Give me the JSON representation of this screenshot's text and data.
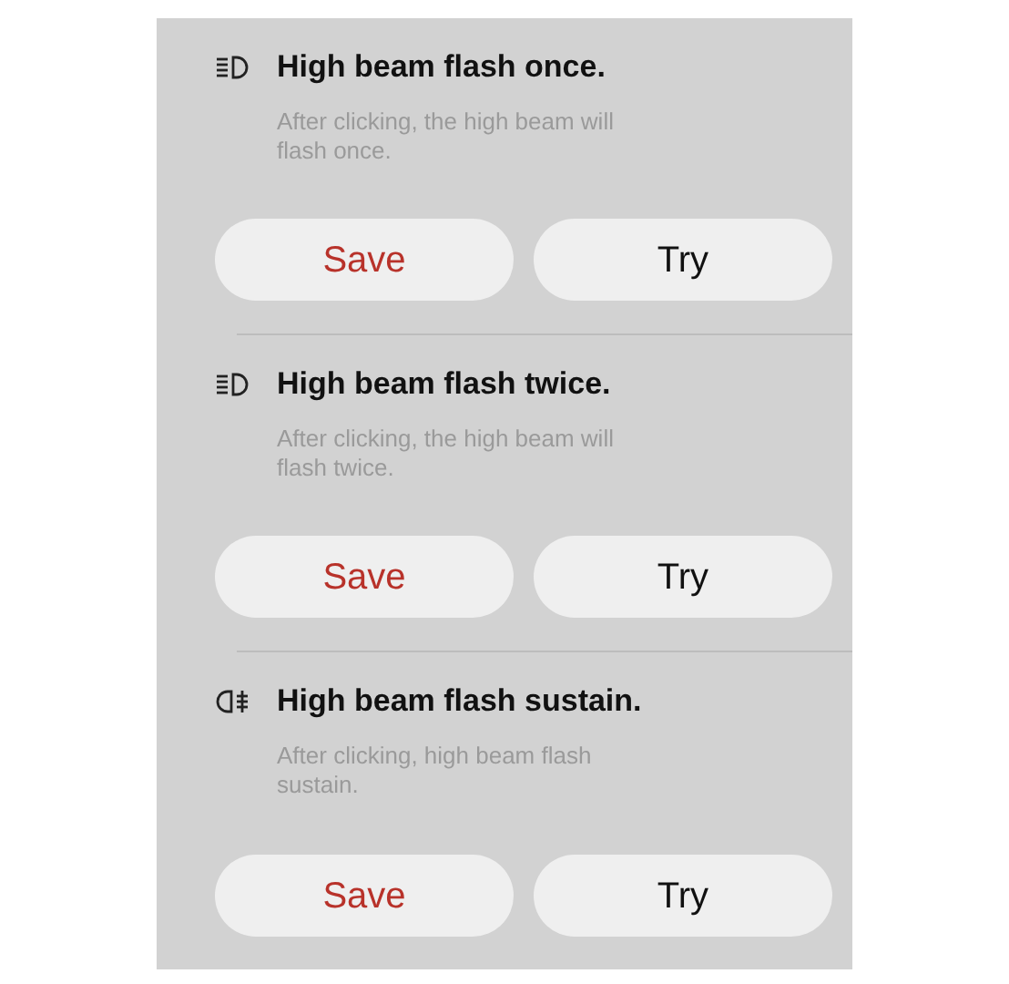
{
  "options": [
    {
      "kind": "beam",
      "title": "High beam flash once.",
      "description": "After clicking, the high beam will flash once.",
      "buttons": [
        {
          "label": "Save",
          "kind": "primary"
        },
        {
          "label": "Try",
          "kind": "secondary"
        }
      ]
    },
    {
      "kind": "beam",
      "title": "High beam flash twice.",
      "description": "After clicking, the high beam will flash twice.",
      "buttons": [
        {
          "label": "Save",
          "kind": "primary"
        },
        {
          "label": "Try",
          "kind": "secondary"
        }
      ]
    },
    {
      "kind": "sustain",
      "title": "High beam flash sustain.",
      "description": "After clicking, high beam flash sustain.",
      "buttons": [
        {
          "label": "Save",
          "kind": "primary"
        },
        {
          "label": "Try",
          "kind": "secondary"
        }
      ]
    }
  ]
}
